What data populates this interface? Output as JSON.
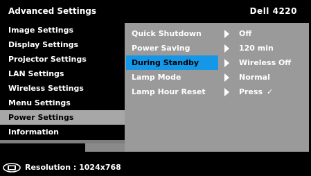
{
  "header": {
    "title": "Advanced Settings",
    "model": "Dell 4220"
  },
  "menu": {
    "items": [
      {
        "label": "Image Settings"
      },
      {
        "label": "Display Settings"
      },
      {
        "label": "Projector Settings"
      },
      {
        "label": "LAN Settings"
      },
      {
        "label": "Wireless Settings"
      },
      {
        "label": "Menu Settings"
      },
      {
        "label": "Power Settings"
      },
      {
        "label": "Information"
      }
    ],
    "active_index": 6
  },
  "power_settings": {
    "rows": [
      {
        "label": "Quick Shutdown",
        "value": "Off"
      },
      {
        "label": "Power Saving",
        "value": "120 min"
      },
      {
        "label": "During Standby",
        "value": "Wireless Off"
      },
      {
        "label": "Lamp Mode",
        "value": "Normal"
      },
      {
        "label": "Lamp Hour Reset",
        "value": "Press",
        "check": "✓"
      }
    ],
    "active_index": 2
  },
  "footer": {
    "resolution": "Resolution : 1024x768",
    "icon": "monitor-icon"
  },
  "colors": {
    "background": "#000000",
    "panel": "#9a9a9a",
    "active_menu": "#a7a7a7",
    "highlight": "#1497e6"
  }
}
